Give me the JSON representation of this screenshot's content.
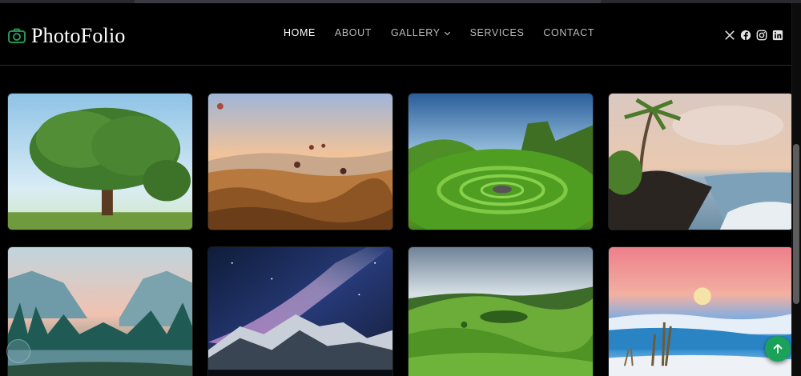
{
  "brand": {
    "name": "PhotoFolio",
    "icon": "camera-icon",
    "accent_color": "#27a65b"
  },
  "nav": {
    "items": [
      {
        "label": "HOME",
        "active": true
      },
      {
        "label": "ABOUT",
        "active": false
      },
      {
        "label": "GALLERY",
        "active": false,
        "has_dropdown": true
      },
      {
        "label": "SERVICES",
        "active": false
      },
      {
        "label": "CONTACT",
        "active": false
      }
    ]
  },
  "social": [
    "x-twitter-icon",
    "facebook-icon",
    "instagram-icon",
    "linkedin-icon"
  ],
  "gallery": {
    "images": [
      {
        "subject": "lone tree in meadow"
      },
      {
        "subject": "hot air balloons over valley"
      },
      {
        "subject": "green spiral hill landscape"
      },
      {
        "subject": "palm tree on rocky beach"
      },
      {
        "subject": "misty mountain valley with river"
      },
      {
        "subject": "milky way over snowy mountains"
      },
      {
        "subject": "rolling green hills"
      },
      {
        "subject": "moon over pink sky and clouds"
      }
    ]
  },
  "back_to_top": {
    "icon": "arrow-up-icon",
    "color": "#1ba25a"
  }
}
